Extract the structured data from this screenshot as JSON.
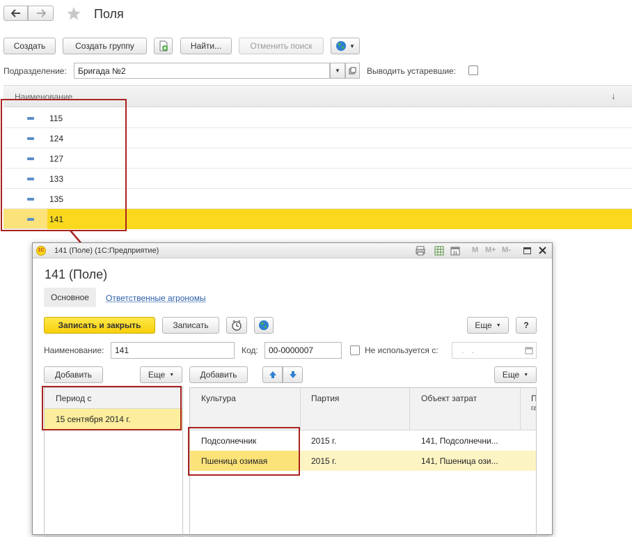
{
  "header": {
    "title": "Поля",
    "back_icon": "arrow-left-icon",
    "forward_icon": "arrow-right-icon",
    "favorite_icon": "star-icon"
  },
  "toolbar": {
    "create": "Создать",
    "create_group": "Создать группу",
    "find": "Найти...",
    "cancel_search": "Отменить поиск"
  },
  "filter": {
    "division_label": "Подразделение:",
    "division_value": "Бригада №2",
    "show_outdated_label": "Выводить устаревшие:"
  },
  "list": {
    "column": "Наименование",
    "sort_glyph": "↓",
    "rows": [
      "115",
      "124",
      "127",
      "133",
      "135",
      "141"
    ]
  },
  "window": {
    "caption_prefix": "141 (Поле) (1С:Предприятие)",
    "toolbar_buttons": [
      "M",
      "M+",
      "M-"
    ],
    "title": "141 (Поле)",
    "tabs": {
      "main": "Основное",
      "agronomists": "Ответственные агрономы"
    },
    "actions": {
      "save_close": "Записать и закрыть",
      "save": "Записать",
      "more": "Еще",
      "help": "?"
    },
    "form": {
      "name_label": "Наименование:",
      "name_value": "141",
      "code_label": "Код:",
      "code_value": "00-0000007",
      "unused_label": "Не используется с:",
      "unused_placeholder": ". ."
    },
    "left_table": {
      "add": "Добавить",
      "more": "Еще",
      "header": "Период с",
      "rows": [
        "15 сентября 2014 г."
      ]
    },
    "right_table": {
      "add": "Добавить",
      "more": "Еще",
      "headers": [
        "Культура",
        "Партия",
        "Объект затрат",
        "П",
        "га"
      ],
      "rows": [
        {
          "culture": "Подсолнечник",
          "batch": "2015 г.",
          "cost_object": "141, Подсолнечни..."
        },
        {
          "culture": "Пшеница озимая",
          "batch": "2015 г.",
          "cost_object": "141, Пшеница ози..."
        }
      ]
    }
  },
  "colors": {
    "selection_yellow": "#f9d81e",
    "annotation_red": "#a8231f",
    "link_blue": "#2b5ea7"
  }
}
